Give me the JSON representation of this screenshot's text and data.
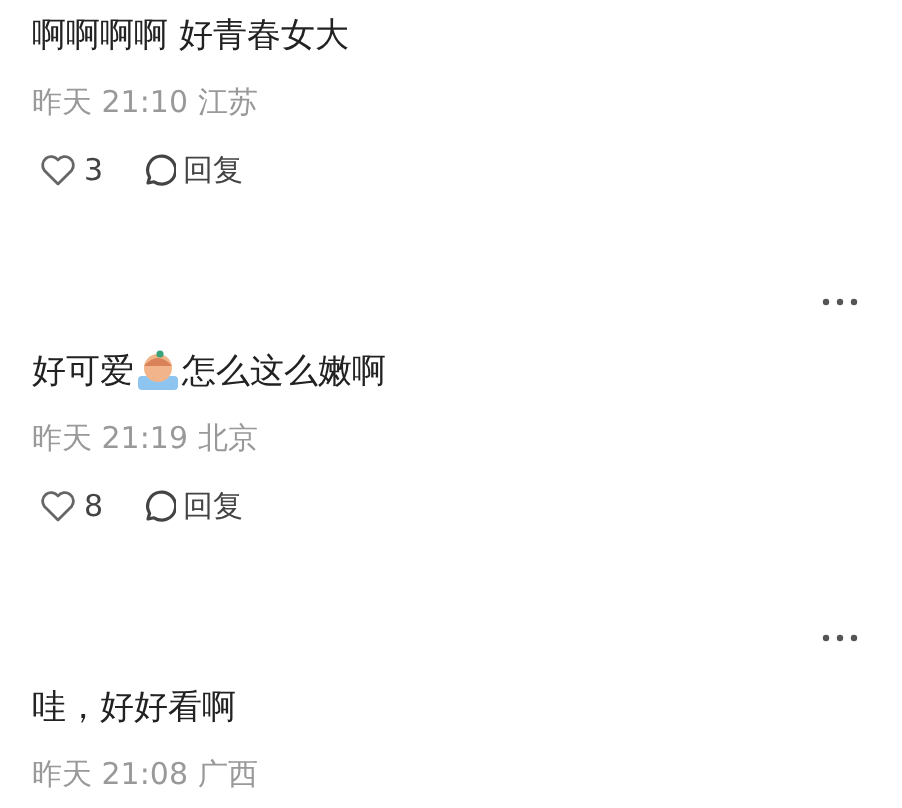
{
  "comments": [
    {
      "has_menu": false,
      "segments": [
        {
          "kind": "text",
          "text": "啊啊啊啊 好青春女大"
        }
      ],
      "time": "昨天 21:10",
      "location": "江苏",
      "likes": "3",
      "reply": "回复"
    },
    {
      "has_menu": true,
      "segments": [
        {
          "kind": "text",
          "text": "好可爱"
        },
        {
          "kind": "sticker"
        },
        {
          "kind": "text",
          "text": "怎么这么嫩啊"
        }
      ],
      "time": "昨天 21:19",
      "location": "北京",
      "likes": "8",
      "reply": "回复"
    },
    {
      "has_menu": true,
      "segments": [
        {
          "kind": "text",
          "text": "哇，好好看啊"
        }
      ],
      "time": "昨天 21:08",
      "location": "广西"
    }
  ]
}
